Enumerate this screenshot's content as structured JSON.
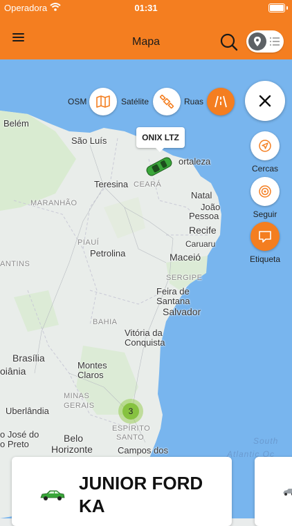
{
  "status_bar": {
    "carrier": "Operadora",
    "time": "01:31"
  },
  "header": {
    "title": "Mapa"
  },
  "map": {
    "layers": [
      {
        "label": "OSM",
        "icon": "map-icon"
      },
      {
        "label": "Satélite",
        "icon": "satellite-icon"
      },
      {
        "label": "Ruas",
        "icon": "road-icon",
        "active": true
      }
    ],
    "actions": [
      {
        "label": "Cercas",
        "icon": "geofence-icon"
      },
      {
        "label": "Seguir",
        "icon": "follow-icon"
      },
      {
        "label": "Etiqueta",
        "icon": "label-icon",
        "active": true
      }
    ],
    "vehicle_tooltip": "ONIX LTZ",
    "cluster_count": "3",
    "places": {
      "belem": "Belém",
      "sao_luis": "São Luís",
      "fortaleza": "ortaleza",
      "teresina": "Teresina",
      "ceara": "CEARÁ",
      "maranhao": "MARANHÃO",
      "natal": "Natal",
      "joao_pessoa_1": "João",
      "joao_pessoa_2": "Pessoa",
      "recife": "Recife",
      "caruaru": "Caruaru",
      "piaui": "PIAUÍ",
      "petrolina": "Petrolina",
      "maceio": "Maceió",
      "tins": "ANTINS",
      "sergipe": "SERGIPE",
      "feira_1": "Feira de",
      "feira_2": "Santana",
      "salvador": "Salvador",
      "bahia": "BAHIA",
      "vitoria_1": "Vitória da",
      "vitoria_2": "Conquista",
      "brasilia": "Brasília",
      "goiania": "oiânia",
      "montes_1": "Montes",
      "montes_2": "Claros",
      "minas_1": "MINAS",
      "minas_2": "GERAIS",
      "uberlandia": "Uberlândia",
      "jose_1": "o José do",
      "jose_2": "o Preto",
      "bh_1": "Belo",
      "bh_2": "Horizonte",
      "es_1": "ESPÍRITO",
      "es_2": "SANTO",
      "campos": "Campos dos",
      "ocean_1": "South",
      "ocean_2": "Atlantic Oc"
    }
  },
  "vehicle_card": {
    "name": "JUNIOR FORD KA"
  },
  "colors": {
    "brand": "#f47e20",
    "car_green": "#3aa63a",
    "cluster": "#86c240"
  }
}
